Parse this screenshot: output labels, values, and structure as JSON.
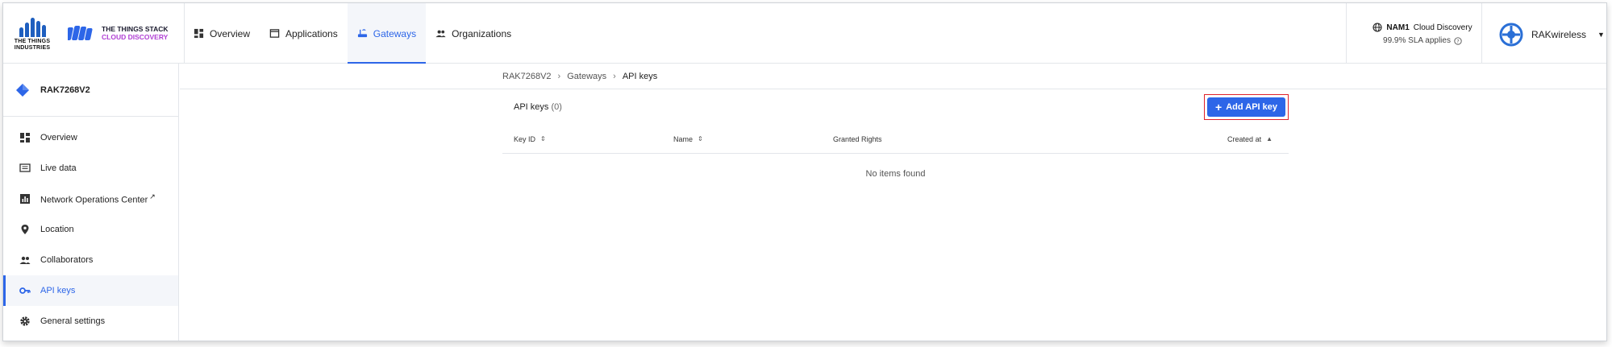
{
  "brand": {
    "tti_line1": "THE THINGS",
    "tti_line2": "INDUSTRIES",
    "stack_line1": "THE THINGS STACK",
    "stack_line2": "CLOUD DISCOVERY",
    "tti_color": "#1f5fbf",
    "stack_accent": "#b03fd4"
  },
  "nav": {
    "tabs": [
      {
        "label": "Overview",
        "icon": "overview-icon"
      },
      {
        "label": "Applications",
        "icon": "applications-icon"
      },
      {
        "label": "Gateways",
        "icon": "gateway-icon",
        "active": true
      },
      {
        "label": "Organizations",
        "icon": "organizations-icon"
      }
    ]
  },
  "cluster": {
    "name": "NAM1",
    "plan": "Cloud Discovery",
    "sla": "99.9% SLA applies"
  },
  "user": {
    "name": "RAKwireless"
  },
  "sidebar": {
    "gateway_name": "RAK7268V2",
    "items": [
      {
        "label": "Overview",
        "icon": "dashboard-icon"
      },
      {
        "label": "Live data",
        "icon": "live-data-icon"
      },
      {
        "label": "Network Operations Center",
        "icon": "chart-icon",
        "external": true
      },
      {
        "label": "Location",
        "icon": "location-pin-icon"
      },
      {
        "label": "Collaborators",
        "icon": "collaborators-icon"
      },
      {
        "label": "API keys",
        "icon": "key-icon",
        "active": true
      },
      {
        "label": "General settings",
        "icon": "gear-icon"
      }
    ]
  },
  "breadcrumb": {
    "items": [
      "RAK7268V2",
      "Gateways",
      "API keys"
    ]
  },
  "table": {
    "title": "API keys",
    "count": "(0)",
    "add_label": "Add API key",
    "columns": {
      "key_id": "Key ID",
      "name": "Name",
      "granted_rights": "Granted Rights",
      "created_at": "Created at"
    },
    "empty_text": "No items found"
  },
  "colors": {
    "accent": "#2d66e8",
    "highlight_border": "#e0202a"
  }
}
